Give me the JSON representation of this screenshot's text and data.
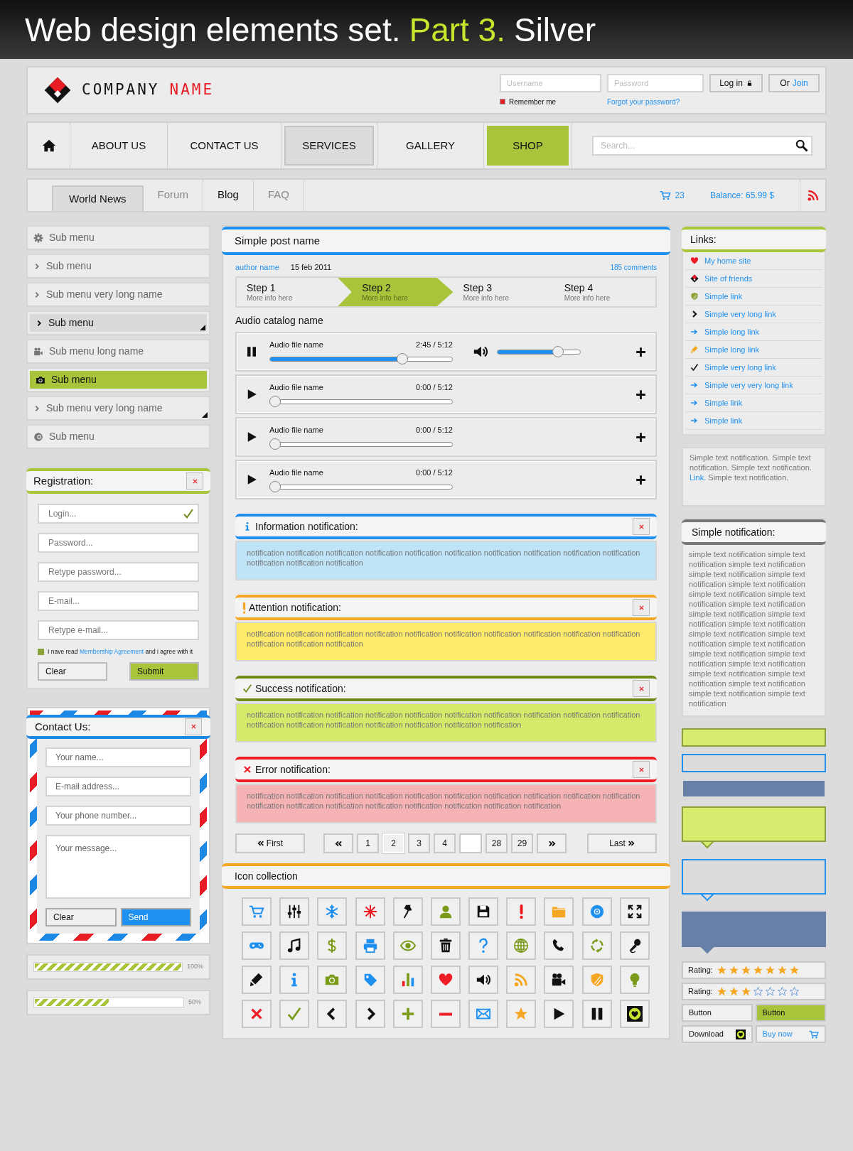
{
  "title": {
    "text": "Web design elements set.",
    "highlight": "Part 3.",
    "suffix": "Silver"
  },
  "header": {
    "logo": {
      "word1": "COMPANY",
      "word2": "NAME"
    },
    "username": {
      "placeholder": "Username"
    },
    "password": {
      "placeholder": "Password"
    },
    "login_button": "Log in",
    "join": {
      "prefix": "Or",
      "link": "Join"
    },
    "remember_me": {
      "label": "Remember me",
      "checked": true
    },
    "forgot_link": "Forgot your password?"
  },
  "nav": {
    "items": [
      {
        "label": "ABOUT US",
        "selected": false,
        "pressed": false
      },
      {
        "label": "CONTACT US",
        "selected": false,
        "pressed": false
      },
      {
        "label": "SERVICES",
        "selected": false,
        "pressed": true
      },
      {
        "label": "GALLERY",
        "selected": false,
        "pressed": false
      },
      {
        "label": "SHOP",
        "selected": true,
        "pressed": false
      }
    ],
    "search": {
      "placeholder": "Search..."
    }
  },
  "tabs": [
    {
      "label": "World News",
      "selected": true,
      "dimmed": false
    },
    {
      "label": "Forum",
      "selected": false,
      "dimmed": true
    },
    {
      "label": "Blog",
      "selected": false,
      "dimmed": false
    },
    {
      "label": "FAQ",
      "selected": false,
      "dimmed": true
    }
  ],
  "cart_count": "23",
  "balance": "Balance: 65.99 $",
  "sidebar": {
    "items": [
      {
        "label": "Sub menu",
        "selected": false,
        "active": false,
        "submenu": false
      },
      {
        "label": "Sub menu",
        "selected": false,
        "active": false,
        "submenu": false
      },
      {
        "label": "Sub menu very long name",
        "selected": false,
        "active": false,
        "submenu": false
      },
      {
        "label": "Sub menu",
        "selected": false,
        "active": true,
        "submenu": true
      },
      {
        "label": "Sub menu long name",
        "selected": false,
        "active": false,
        "submenu": false
      },
      {
        "label": "Sub menu",
        "selected": true,
        "active": false,
        "submenu": false
      },
      {
        "label": "Sub menu very long name",
        "selected": false,
        "active": false,
        "submenu": true
      },
      {
        "label": "Sub menu",
        "selected": false,
        "active": false,
        "submenu": false
      }
    ]
  },
  "registration": {
    "title": "Registration:",
    "fields": [
      {
        "placeholder": "Login...",
        "valid": true
      },
      {
        "placeholder": "Password...",
        "valid": false
      },
      {
        "placeholder": "Retype password...",
        "valid": false
      },
      {
        "placeholder": "E-mail...",
        "valid": false
      },
      {
        "placeholder": "Retype e-mail...",
        "valid": false
      }
    ],
    "agreement": {
      "checked": true,
      "before": "I nave read",
      "link": "Membership Agreement",
      "after": "and i agree with it"
    },
    "buttons": [
      {
        "label": "Clear",
        "primary": false
      },
      {
        "label": "Submit",
        "primary": true
      }
    ]
  },
  "contact": {
    "title": "Contact Us:",
    "fields": [
      {
        "placeholder": "Your name..."
      },
      {
        "placeholder": "E-mail address..."
      },
      {
        "placeholder": "Your phone number..."
      }
    ],
    "message": {
      "placeholder": "Your message..."
    },
    "buttons": [
      {
        "label": "Clear",
        "primary": false
      },
      {
        "label": "Send",
        "primary": true
      }
    ]
  },
  "progress": [
    {
      "level": 1,
      "reading": "100%"
    },
    {
      "level": 0.5,
      "reading": "50%"
    }
  ],
  "post": {
    "title": "Simple post name",
    "author": "author name",
    "date": "15 feb 2011",
    "comments": "185 comments",
    "steps": [
      {
        "title": "Step 1",
        "info": "More info here",
        "selected": false
      },
      {
        "title": "Step 2",
        "info": "More info here",
        "selected": true
      },
      {
        "title": "Step 3",
        "info": "More info here",
        "selected": false
      },
      {
        "title": "Step 4",
        "info": "More info here",
        "selected": false
      }
    ]
  },
  "audio": {
    "title": "Audio catalog name",
    "tracks": [
      {
        "name": "Audio file name",
        "time": "2:45 / 5:12",
        "playing": true,
        "level": 0.74,
        "volume": {
          "level": 0.76
        }
      },
      {
        "name": "Audio file name",
        "time": "0:00 / 5:12",
        "playing": false,
        "level": 0
      },
      {
        "name": "Audio file name",
        "time": "0:00 / 5:12",
        "playing": false,
        "level": 0
      },
      {
        "name": "Audio file name",
        "time": "0:00 / 5:12",
        "playing": false,
        "level": 0
      }
    ]
  },
  "notifications": [
    {
      "kind": "info",
      "title": "Information notification:",
      "text": "notification notification notification notification notification notification notification notification notification notification notification notification notification"
    },
    {
      "kind": "attention",
      "title": "Attention notification:",
      "text": "notification notification notification notification notification notification notification notification notification notification notification notification notification"
    },
    {
      "kind": "success",
      "title": "Success notification:",
      "text": "notification notification notification notification notification notification notification notification notification notification notification notification notification notification notification notification notification"
    },
    {
      "kind": "error",
      "title": "Error notification:",
      "text": "notification notification notification notification notification notification notification notification notification notification notification notification notification notification notification notification notification notification"
    }
  ],
  "pagination": {
    "first": "First",
    "last": "Last",
    "pages": [
      {
        "kind": "page",
        "label": "1",
        "selected": false
      },
      {
        "kind": "page",
        "label": "2",
        "selected": true
      },
      {
        "kind": "page",
        "label": "3",
        "selected": false
      },
      {
        "kind": "page",
        "label": "4",
        "selected": false
      },
      {
        "kind": "input"
      },
      {
        "kind": "page",
        "label": "28",
        "selected": false
      },
      {
        "kind": "page",
        "label": "29",
        "selected": false
      }
    ]
  },
  "icon_collection": {
    "title": "Icon collection"
  },
  "links": {
    "title": "Links:",
    "items": [
      "My home site",
      "Site of friends",
      "Simple link",
      "Simple very long link",
      "Simple long link",
      "Simple long link",
      "Simple very long link",
      "Simple very very long link",
      "Simple link",
      "Simple link"
    ]
  },
  "text_notification": {
    "before": "Simple text notification. Simple text notification. Simple text notification.",
    "link": "Link.",
    "after": "Simple text notification."
  },
  "simple_notification": {
    "title": "Simple notification:",
    "text": "simple text notification simple text notification simple text notification simple text notification simple text notification simple text notification simple text notification simple text notification simple text notification simple text notification simple text notification simple text notification simple text notification simple text notification simple text notification simple text notification simple text notification simple text notification simple text notification simple text notification simple text notification simple text notification simple text notification"
  },
  "ratings": [
    {
      "label": "Rating:",
      "stars": 7
    },
    {
      "label": "Rating:",
      "stars": 3
    }
  ],
  "buttons": [
    {
      "label": "Button",
      "primary": false
    },
    {
      "label": "Button",
      "primary": true
    }
  ],
  "download": "Download",
  "buy_now": "Buy now"
}
